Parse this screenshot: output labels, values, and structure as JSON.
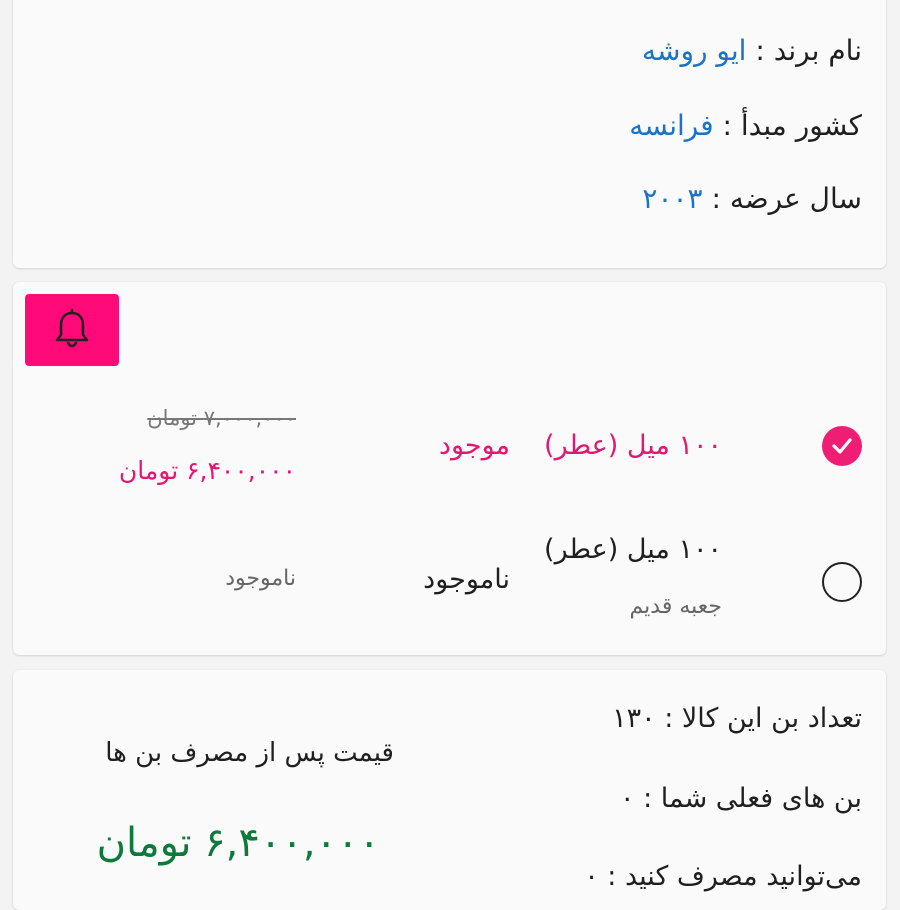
{
  "brand": {
    "brand_label": "نام برند :",
    "brand_value": "ایو روشه",
    "country_label": "کشور مبدأ :",
    "country_value": "فرانسه",
    "year_label": "سال عرضه :",
    "year_value": "۲۰۰۳"
  },
  "variants": {
    "items": [
      {
        "name": "۱۰۰ میل (عطر)",
        "subtitle": "",
        "status": "موجود",
        "old_price": "۷,۰۰۰,۰۰۰ تومان",
        "price": "۶,۴۰۰,۰۰۰ تومان",
        "selected": true
      },
      {
        "name": "۱۰۰ میل (عطر)",
        "subtitle": "جعبه قدیم",
        "status": "ناموجود",
        "price_status": "ناموجود",
        "selected": false
      }
    ],
    "bell_icon": "bell-icon",
    "accent_color": "#ff0a78"
  },
  "bon": {
    "count_line": "تعداد بن این کالا : ۱۳۰",
    "current_line": "بن های فعلی شما : ۰",
    "usable_line": "می‌توانید مصرف کنید : ۰",
    "after_label": "قیمت پس از مصرف بن ها",
    "after_price": "۶,۴۰۰,۰۰۰ تومان"
  }
}
